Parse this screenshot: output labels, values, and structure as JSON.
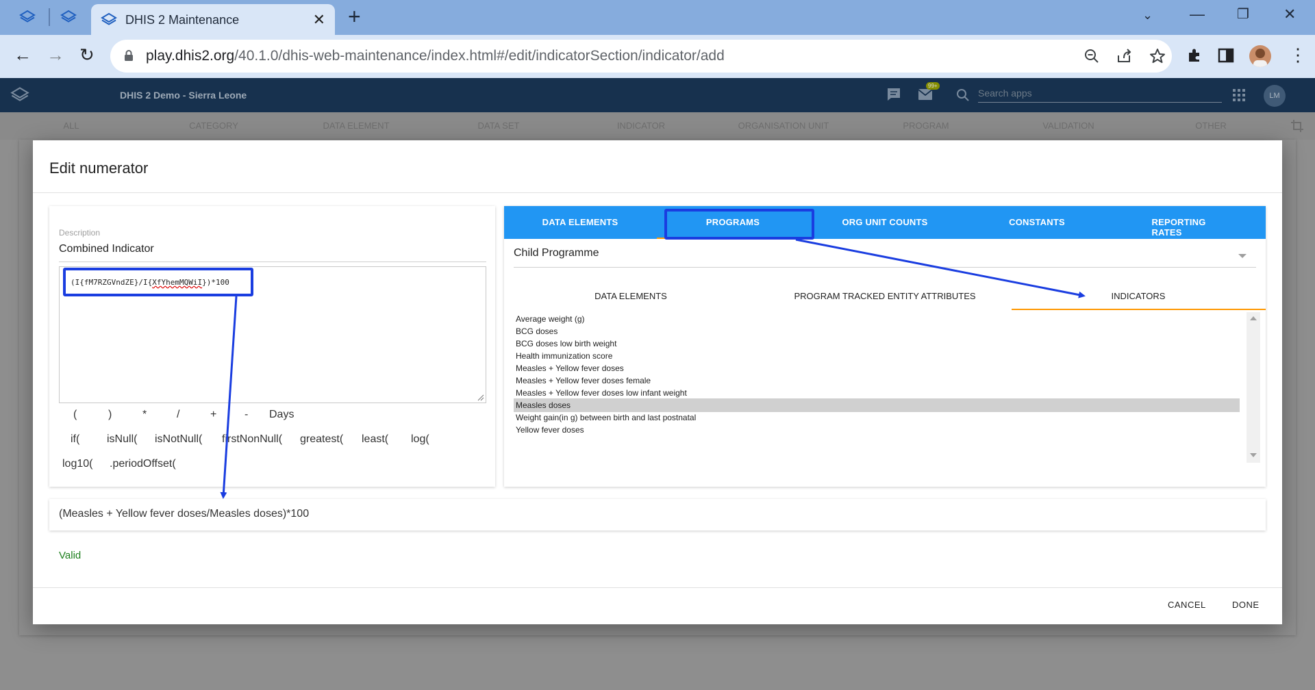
{
  "browser": {
    "tab_title": "DHIS 2 Maintenance",
    "url_host": "play.dhis2.org",
    "url_path": "/40.1.0/dhis-web-maintenance/index.html#/edit/indicatorSection/indicator/add"
  },
  "dhis_header": {
    "instance_title": "DHIS 2 Demo - Sierra Leone",
    "message_badge": "99+",
    "search_placeholder": "Search apps",
    "profile_initials": "LM"
  },
  "sections": [
    "ALL",
    "CATEGORY",
    "DATA ELEMENT",
    "DATA SET",
    "INDICATOR",
    "ORGANISATION UNIT",
    "PROGRAM",
    "VALIDATION",
    "OTHER"
  ],
  "dialog": {
    "title": "Edit numerator",
    "description_label": "Description",
    "description_value": "Combined Indicator",
    "formula_prefix": "(I{fM7RZGVndZE}/I{",
    "formula_squiggle": "XfYhemMQWiI",
    "formula_suffix": "})*100",
    "operators_row1": [
      "(",
      ")",
      "*",
      "/",
      "+",
      "-",
      "Days"
    ],
    "operators_row2": [
      "if(",
      "isNull(",
      "isNotNull(",
      "firstNonNull(",
      "greatest(",
      "least(",
      "log("
    ],
    "operators_row3": [
      "log10(",
      ".periodOffset("
    ],
    "main_tabs": [
      "DATA ELEMENTS",
      "PROGRAMS",
      "ORG UNIT COUNTS",
      "CONSTANTS",
      "REPORTING RATES"
    ],
    "selected_program": "Child Programme",
    "sub_tabs": [
      "DATA ELEMENTS",
      "PROGRAM TRACKED ENTITY ATTRIBUTES",
      "INDICATORS"
    ],
    "indicators": [
      "Average weight (g)",
      "BCG doses",
      "BCG doses low birth weight",
      "Health immunization score",
      "Measles + Yellow fever doses",
      "Measles + Yellow fever doses female",
      "Measles + Yellow fever doses low infant weight",
      "Measles doses",
      "Weight gain(in g) between birth and last postnatal",
      "Yellow fever doses"
    ],
    "selected_indicator_index": 7,
    "readable_formula": "(Measles + Yellow fever doses/Measles doses)*100",
    "validation_status": "Valid",
    "cancel_label": "CANCEL",
    "done_label": "DONE"
  },
  "colors": {
    "tab_bar_blue": "#2196f3",
    "ink_orange": "#ff9800",
    "annotation_blue": "#1a3de0",
    "valid_green": "#1b7e1b"
  }
}
